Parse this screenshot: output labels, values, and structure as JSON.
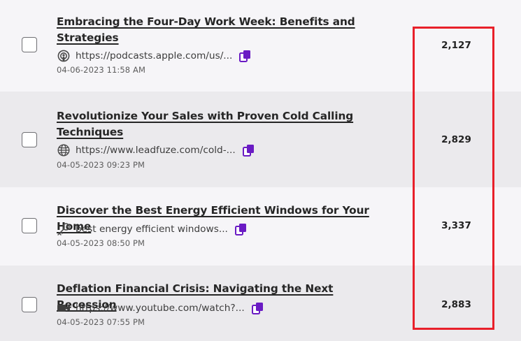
{
  "rows": [
    {
      "title": "Embracing the Four-Day Work Week: Benefits and Strategies",
      "source_icon": "podcast-icon",
      "source": "https://podcasts.apple.com/us/...",
      "date": "04-06-2023 11:58 AM",
      "count": "2,127"
    },
    {
      "title": "Revolutionize Your Sales with Proven Cold Calling Techniques",
      "source_icon": "globe-icon",
      "source": "https://www.leadfuze.com/cold-...",
      "date": "04-05-2023 09:23 PM",
      "count": "2,829"
    },
    {
      "title": "Discover the Best Energy Efficient Windows for Your Home",
      "source_icon": "key-icon",
      "source": "best energy efficient windows...",
      "date": "04-05-2023 08:50 PM",
      "count": "3,337"
    },
    {
      "title": "Deflation Financial Crisis: Navigating the Next Recession",
      "source_icon": "video-camera-icon",
      "source": "https://www.youtube.com/watch?...",
      "date": "04-05-2023 07:55 PM",
      "count": "2,883"
    }
  ],
  "colors": {
    "accent": "#6a1bc4",
    "highlight_border": "#e8202a",
    "row_light": "#f6f5f8",
    "row_dark": "#ebeaed"
  }
}
